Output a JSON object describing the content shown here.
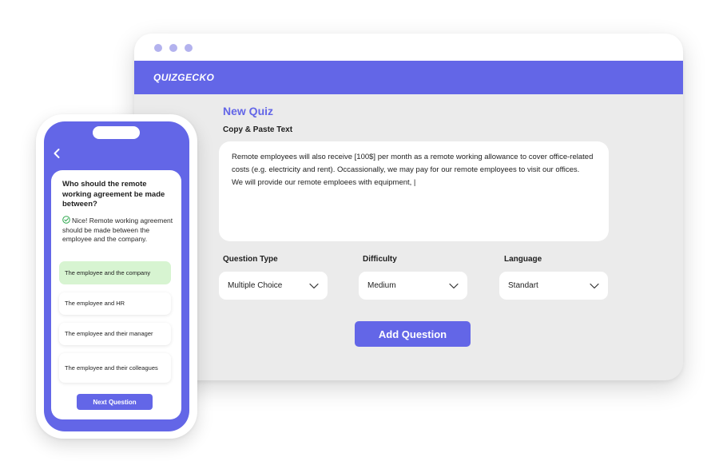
{
  "browser": {
    "brand": "QUIZGECKO",
    "page_title": "New Quiz",
    "text_label": "Copy & Paste Text",
    "text_lines": [
      "Remote employees will also receive [100$] per month as a remote working allowance to cover office-related",
      "costs (e.g. electricity and rent). Occassionally, we may pay for our remote employees to visit our offices.",
      "We will provide our remote emploees with equipment, |"
    ],
    "question_type": {
      "label": "Question Type",
      "value": "Multiple Choice"
    },
    "difficulty": {
      "label": "Difficulty",
      "value": "Medium"
    },
    "language": {
      "label": "Language",
      "value": "Standart"
    },
    "add_button": "Add Question",
    "colors": {
      "accent": "#6366e7",
      "window_dots": "#b3b2ee",
      "body": "#ebebeb"
    }
  },
  "phone": {
    "question": "Who should the remote working agreement be made between?",
    "feedback": "Nice! Remote working agreement should be made between the employee and the company.",
    "options": [
      {
        "label": "The employee and the company",
        "correct": true
      },
      {
        "label": "The employee and HR",
        "correct": false
      },
      {
        "label": "The employee and their manager",
        "correct": false
      },
      {
        "label": "The employee and their colleagues",
        "correct": false
      }
    ],
    "next_button": "Next Question",
    "icons": {
      "back": "chevron-left-icon",
      "feedback": "check-circle-icon"
    },
    "colors": {
      "correct_bg": "#d7f4d1",
      "check": "#2fa84f"
    }
  }
}
